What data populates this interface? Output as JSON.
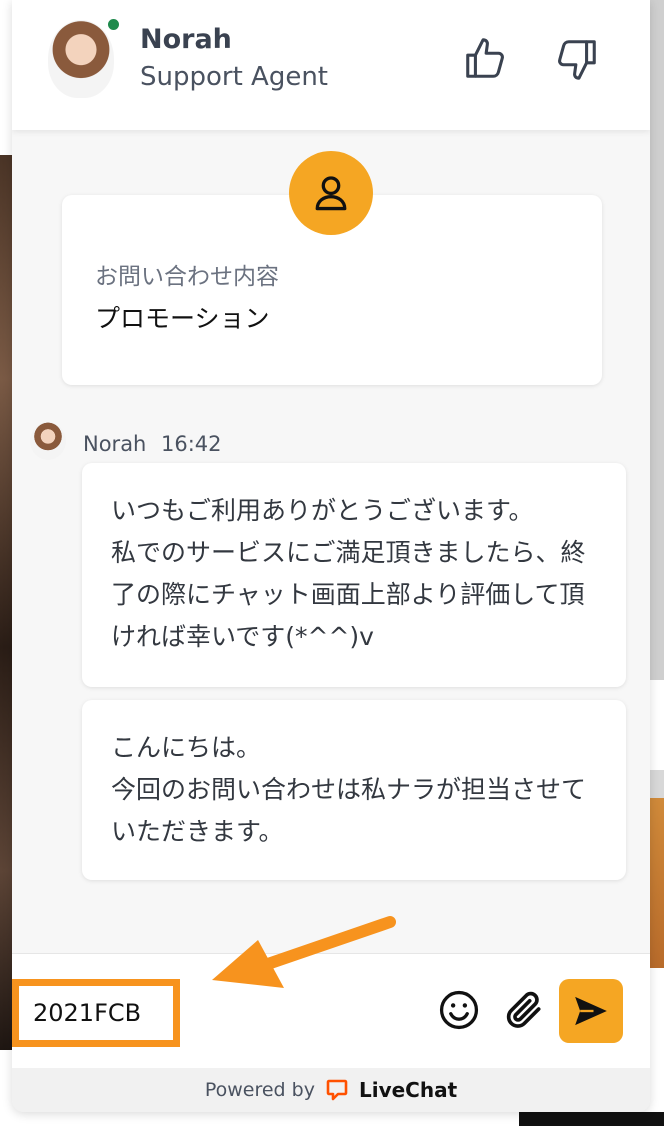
{
  "header": {
    "agent_name": "Norah",
    "agent_role": "Support Agent",
    "status": "online"
  },
  "form": {
    "label": "お問い合わせ内容",
    "value": "プロモーション"
  },
  "message_meta": {
    "author": "Norah",
    "time": "16:42"
  },
  "messages": [
    {
      "text": "いつもご利用ありがとうございます。\n私でのサービスにご満足頂きましたら、終了の際にチャット画面上部より評価して頂ければ幸いです(*^^)v"
    },
    {
      "text": "こんにちは。\n今回のお問い合わせは私ナラが担当させていただきます。"
    }
  ],
  "input": {
    "value": "2021FCB"
  },
  "footer": {
    "powered_by": "Powered by",
    "brand": "LiveChat"
  },
  "colors": {
    "accent": "#f5a623",
    "annotation": "#f7931e",
    "online": "#1f8a4c",
    "livechat_brand": "#ff5100"
  },
  "icons": [
    "thumbs-up-icon",
    "thumbs-down-icon",
    "user-icon",
    "emoji-icon",
    "paperclip-icon",
    "send-icon",
    "livechat-logo-icon"
  ]
}
